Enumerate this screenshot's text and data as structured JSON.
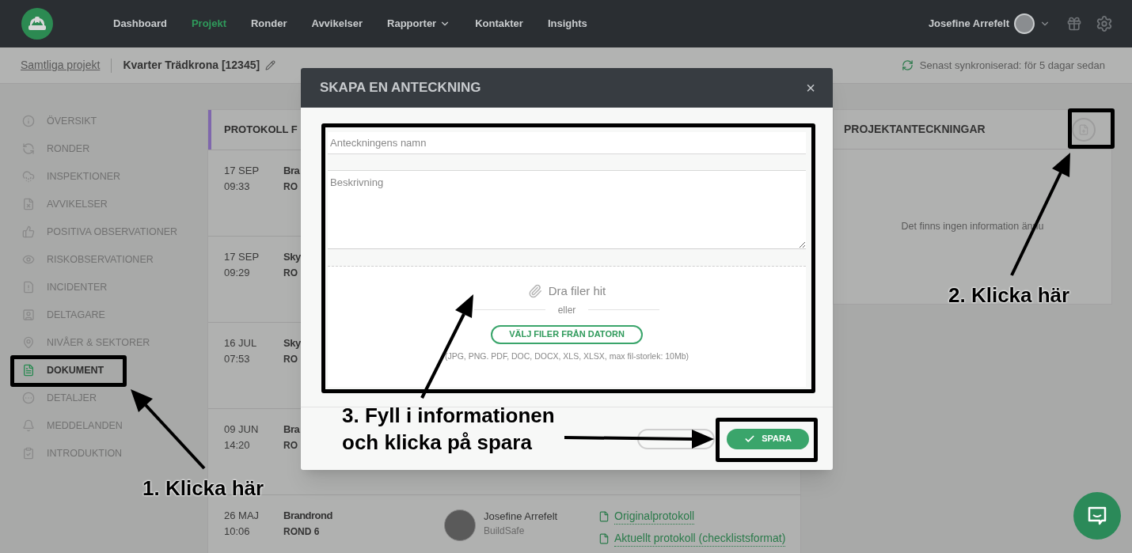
{
  "nav": {
    "items": [
      {
        "label": "Dashboard",
        "selected": false,
        "dropdown": false
      },
      {
        "label": "Projekt",
        "selected": true,
        "dropdown": false
      },
      {
        "label": "Ronder",
        "selected": false,
        "dropdown": false
      },
      {
        "label": "Avvikelser",
        "selected": false,
        "dropdown": false
      },
      {
        "label": "Rapporter",
        "selected": false,
        "dropdown": true
      },
      {
        "label": "Kontakter",
        "selected": false,
        "dropdown": false
      },
      {
        "label": "Insights",
        "selected": false,
        "dropdown": false
      }
    ],
    "user": {
      "name": "Josefine Arrefelt"
    }
  },
  "breadcrumb": {
    "link": "Samtliga projekt",
    "project": "Kvarter Trädkrona [12345]",
    "sync_status": "Senast synkroniserad: för 5 dagar sedan"
  },
  "sidebar": {
    "items": [
      {
        "label": "ÖVERSIKT",
        "selected": false
      },
      {
        "label": "RONDER",
        "selected": false
      },
      {
        "label": "INSPEKTIONER",
        "selected": false
      },
      {
        "label": "AVVIKELSER",
        "selected": false
      },
      {
        "label": "POSITIVA OBSERVATIONER",
        "selected": false
      },
      {
        "label": "RISKOBSERVATIONER",
        "selected": false
      },
      {
        "label": "INCIDENTER",
        "selected": false
      },
      {
        "label": "DELTAGARE",
        "selected": false
      },
      {
        "label": "NIVÅER & SEKTORER",
        "selected": false
      },
      {
        "label": "DOKUMENT",
        "selected": true
      },
      {
        "label": "DETALJER",
        "selected": false
      },
      {
        "label": "MEDDELANDEN",
        "selected": false
      },
      {
        "label": "INTRODUKTION",
        "selected": false
      }
    ]
  },
  "protocols": {
    "title": "PROTOKOLL F",
    "rows": [
      {
        "date": "17 SEP",
        "time": "09:33",
        "title": "Bra",
        "subtitle": "RO"
      },
      {
        "date": "17 SEP",
        "time": "09:29",
        "title": "Sky",
        "subtitle": "RO"
      },
      {
        "date": "16 JUL",
        "time": "07:53",
        "title": "Sky",
        "subtitle": "RO"
      },
      {
        "date": "09 JUN",
        "time": "14:20",
        "title": "Bra",
        "subtitle": "RO"
      },
      {
        "date": "26 MAJ",
        "time": "10:06",
        "title": "Brandrond",
        "subtitle": "ROND 6",
        "author": {
          "name": "Josefine Arrefelt",
          "company": "BuildSafe"
        },
        "links": [
          "Originalprotokoll",
          "Aktuellt protokoll (checklistsformat)"
        ]
      }
    ]
  },
  "notes_panel": {
    "title": "PROJEKTANTECKNINGAR",
    "empty_text": "Det finns ingen information ännu"
  },
  "modal": {
    "title": "SKAPA EN ANTECKNING",
    "close": "×",
    "name_field": {
      "placeholder": "Anteckningens namn"
    },
    "description_field": {
      "placeholder": "Beskrivning"
    },
    "dropzone": {
      "text": "Dra filer hit",
      "separator": "eller",
      "button": "VÄLJ FILER FRÅN DATORN",
      "hint": "(JPG, PNG. PDF, DOC, DOCX, XLS, XLSX, max fil-storlek: 10Mb)"
    },
    "save_button": "SPARA"
  },
  "annotations": [
    {
      "lines": [
        "1. Klicka här"
      ]
    },
    {
      "lines": [
        "2. Klicka här"
      ]
    },
    {
      "lines": [
        "3. Fyll i informationen",
        "och klicka på spara"
      ]
    }
  ]
}
